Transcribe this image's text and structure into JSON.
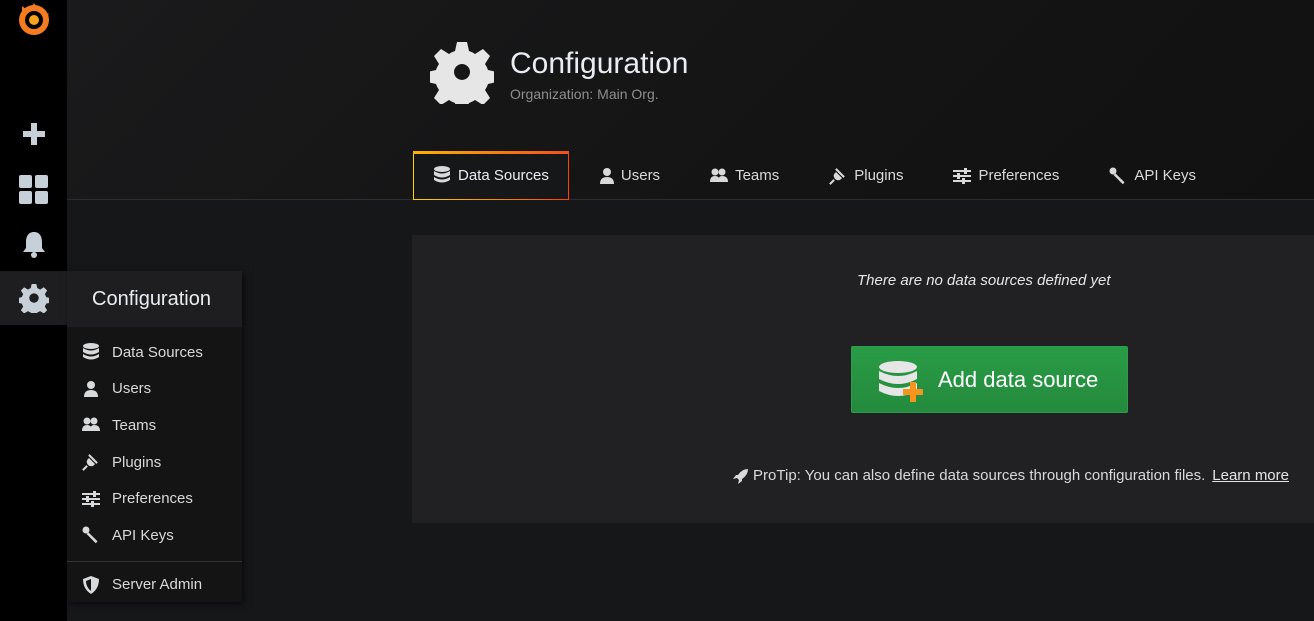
{
  "header": {
    "title": "Configuration",
    "subtitle": "Organization: Main Org."
  },
  "tabs": [
    {
      "label": "Data Sources",
      "icon": "database-icon",
      "active": true
    },
    {
      "label": "Users",
      "icon": "user-icon"
    },
    {
      "label": "Teams",
      "icon": "users-icon"
    },
    {
      "label": "Plugins",
      "icon": "plug-icon"
    },
    {
      "label": "Preferences",
      "icon": "sliders-icon"
    },
    {
      "label": "API Keys",
      "icon": "key-icon"
    }
  ],
  "panel": {
    "empty_message": "There are no data sources defined yet",
    "add_button_label": "Add data source",
    "protip": "ProTip: You can also define data sources through configuration files.",
    "learn_more": "Learn more"
  },
  "dropdown": {
    "title": "Configuration",
    "items": [
      {
        "label": "Data Sources",
        "icon": "database-icon"
      },
      {
        "label": "Users",
        "icon": "user-icon"
      },
      {
        "label": "Teams",
        "icon": "users-icon"
      },
      {
        "label": "Plugins",
        "icon": "plug-icon"
      },
      {
        "label": "Preferences",
        "icon": "sliders-icon"
      },
      {
        "label": "API Keys",
        "icon": "key-icon"
      }
    ],
    "admin_label": "Server Admin"
  },
  "colors": {
    "accent_green": "#299c46",
    "tab_gradient_start": "#ffb200",
    "tab_gradient_end": "#f0501e",
    "logo_orange": "#f47b20"
  }
}
